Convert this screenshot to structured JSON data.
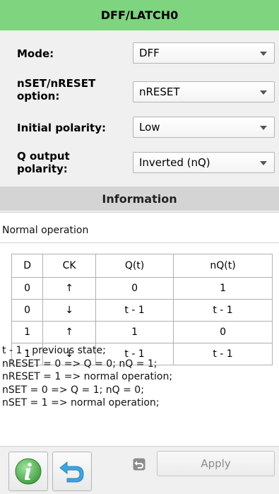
{
  "panel": {
    "title": "DFF/LATCH0"
  },
  "form": {
    "mode": {
      "label": "Mode:",
      "value": "DFF"
    },
    "nset_option": {
      "label_line1": "nSET/nRESET",
      "label_line2": "option:",
      "value": "nRESET"
    },
    "initial_polarity": {
      "label": "Initial polarity:",
      "value": "Low"
    },
    "q_output_polarity": {
      "label_line1": "Q output",
      "label_line2": "polarity:",
      "value": "Inverted (nQ)"
    }
  },
  "information": {
    "header": "Information",
    "caption": "Normal operation",
    "table": {
      "columns": [
        "D",
        "CK",
        "Q(t)",
        "nQ(t)"
      ],
      "rows": [
        [
          "0",
          "↑",
          "0",
          "1"
        ],
        [
          "0",
          "↓",
          "t - 1",
          "t - 1"
        ],
        [
          "1",
          "↑",
          "1",
          "0"
        ],
        [
          "1",
          "↓",
          "t - 1",
          "t - 1"
        ]
      ]
    },
    "notes": [
      "t - 1 - previous state;",
      "nRESET = 0 => Q = 0; nQ = 1;",
      "nRESET = 1 => normal operation;",
      "nSET = 0 => Q = 1; nQ = 0;",
      "nSET = 1 => normal operation;"
    ]
  },
  "footer": {
    "info_icon": "info-icon",
    "undo_icon": "undo-icon",
    "apply_label": "Apply"
  },
  "colors": {
    "title_bar": "#7fd47f",
    "info_header": "#d4d4d4",
    "info_green": "#5cb85c",
    "undo_blue": "#3fa3e0"
  }
}
